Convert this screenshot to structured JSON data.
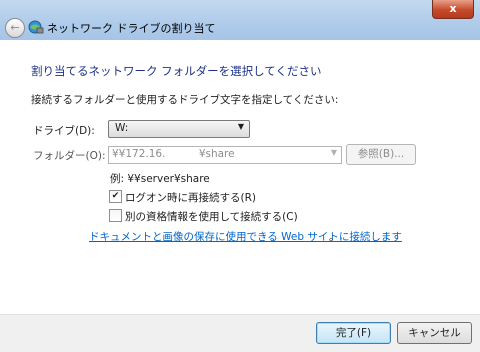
{
  "window": {
    "title": "ネットワーク ドライブの割り当て",
    "close_label": "x",
    "back_label": "←"
  },
  "heading": "割り当てるネットワーク フォルダーを選択してください",
  "instruction": "接続するフォルダーと使用するドライブ文字を指定してください:",
  "drive": {
    "label": "ドライブ(D):",
    "value": "W:"
  },
  "folder": {
    "label": "フォルダー(O):",
    "value": "¥¥172.16.          ¥share",
    "browse_label": "参照(B)..."
  },
  "example": "例: ¥¥server¥share",
  "options": [
    {
      "label": "ログオン時に再接続する(R)",
      "checked": true
    },
    {
      "label": "別の資格情報を使用して接続する(C)",
      "checked": false
    }
  ],
  "link": {
    "text": "ドキュメントと画像の保存に使用できる Web サイトに接続します",
    "suffix": "。"
  },
  "buttons": {
    "finish": "完了(F)",
    "cancel": "キャンセル"
  },
  "colors": {
    "heading": "#1e3287",
    "link": "#0066cc",
    "titlebar": "#aecbea"
  }
}
